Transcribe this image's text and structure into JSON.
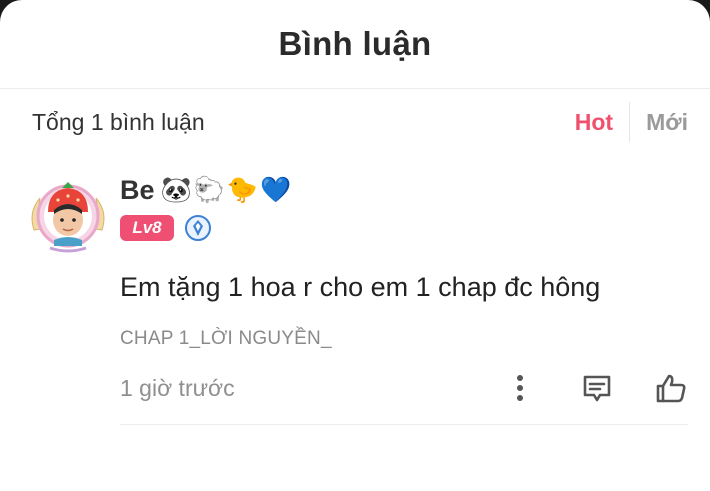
{
  "sheet": {
    "title": "Bình luận"
  },
  "summary": {
    "total_text": "Tổng 1 bình luận",
    "sort_hot": "Hot",
    "sort_new": "Mới"
  },
  "comment": {
    "username": "Be",
    "emojis": [
      "🐼",
      "🐑",
      "🐤",
      "💙"
    ],
    "level": "Lv8",
    "body": "Em tặng 1 hoa r cho em 1 chap đc hông",
    "chapter": "CHAP 1_LỜI NGUYỀN_",
    "time": "1 giờ trước",
    "icons": {
      "more": "more-vertical-icon",
      "reply": "reply-icon",
      "like": "thumbs-up-icon",
      "vip": "vip-badge-icon"
    }
  },
  "colors": {
    "accent": "#f0506e",
    "level_badge": "#ee4f72",
    "muted": "#8f8f8f"
  }
}
